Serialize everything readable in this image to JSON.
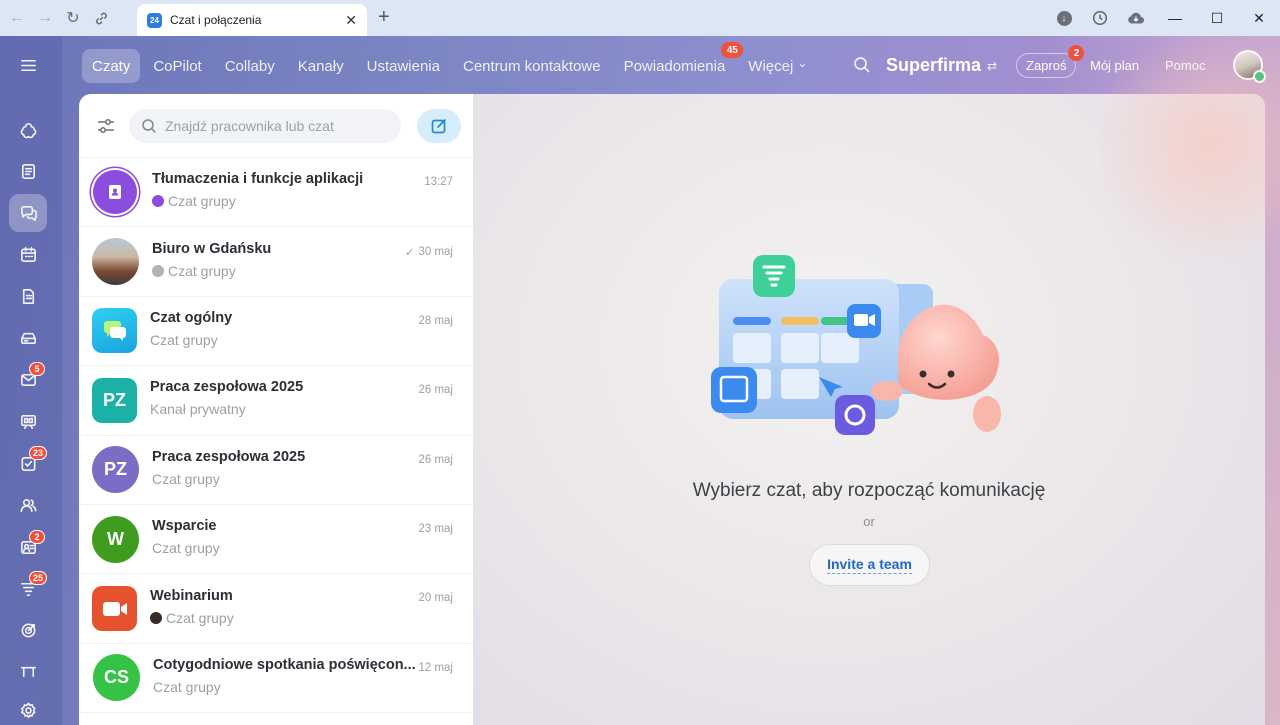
{
  "browser": {
    "tab_title": "Czat i połączenia",
    "tab_favicon": "24"
  },
  "topnav": {
    "tabs": [
      {
        "label": "Czaty",
        "active": true
      },
      {
        "label": "CoPilot"
      },
      {
        "label": "Collaby"
      },
      {
        "label": "Kanały"
      },
      {
        "label": "Ustawienia"
      },
      {
        "label": "Centrum kontaktowe"
      },
      {
        "label": "Powiadomienia",
        "badge": "45"
      },
      {
        "label": "Więcej"
      }
    ],
    "more_chevron": "⌄",
    "brand": "Superfirma",
    "invite_label": "Zaproś",
    "invite_badge": "2",
    "plan_label": "Mój plan",
    "help_label": "Pomoc"
  },
  "sidebar": {
    "badges": {
      "mail": "5",
      "tasks": "23",
      "crm": "2",
      "feed": "25"
    }
  },
  "chatlist": {
    "search_placeholder": "Znajdź pracownika lub czat",
    "items": [
      {
        "name": "Tłumaczenia i funkcje aplikacji",
        "subtitle": "Czat grupy",
        "time": "13:27"
      },
      {
        "name": "Biuro w Gdańsku",
        "subtitle": "Czat grupy",
        "time": "30 maj",
        "check": "✓"
      },
      {
        "name": "Czat ogólny",
        "subtitle": "Czat grupy",
        "time": "28 maj"
      },
      {
        "name": "Praca zespołowa 2025",
        "subtitle": "Kanał prywatny",
        "time": "26 maj",
        "initials": "PZ"
      },
      {
        "name": "Praca zespołowa 2025",
        "subtitle": "Czat grupy",
        "time": "26 maj",
        "initials": "PZ"
      },
      {
        "name": "Wsparcie",
        "subtitle": "Czat grupy",
        "time": "23 maj",
        "initials": "W"
      },
      {
        "name": "Webinarium",
        "subtitle": "Czat grupy",
        "time": "20 maj"
      },
      {
        "name": "Cotygodniowe spotkania poświęcon...",
        "subtitle": "Czat grupy",
        "time": "12 maj",
        "initials": "CS"
      }
    ]
  },
  "empty_state": {
    "title": "Wybierz czat, aby rozpocząć komunikację",
    "or": "or",
    "button": "Invite a team"
  },
  "colors": {
    "accent": "#2266cc",
    "badge": "#f0503c"
  }
}
